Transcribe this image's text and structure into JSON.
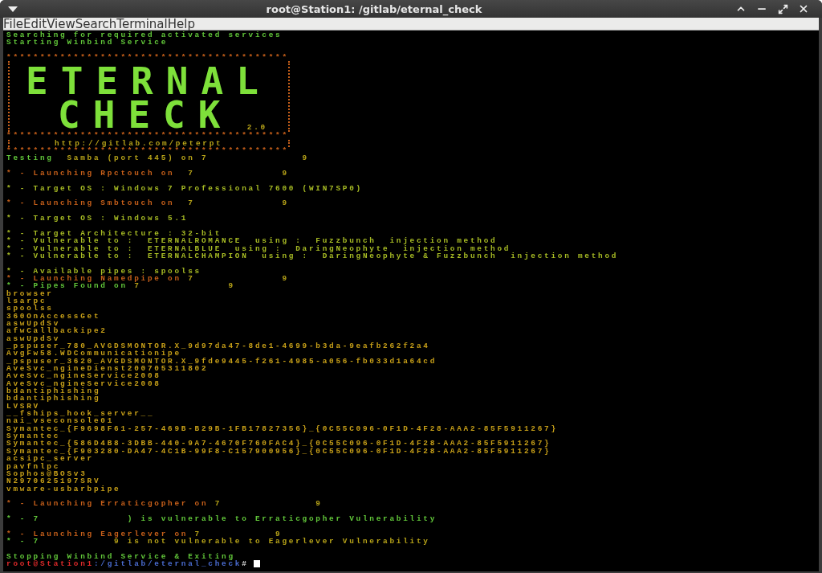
{
  "window": {
    "title": "root@Station1: /gitlab/eternal_check"
  },
  "menu": [
    "File",
    "Edit",
    "View",
    "Search",
    "Terminal",
    "Help"
  ],
  "output": [
    {
      "kind": "text",
      "lines": [
        [
          {
            "text": "Searching for required activated services",
            "color": "#62c83a"
          }
        ],
        [
          {
            "text": "Starting Winbind Service",
            "color": "#62c83a"
          }
        ]
      ]
    },
    {
      "kind": "banner",
      "border": "******************************************",
      "logo": [
        "ETERNAL",
        "CHECK"
      ],
      "version": "2.0",
      "url": "http://gitlab.com/peterpt"
    },
    {
      "kind": "text",
      "lines": [
        [
          {
            "text": "Testing  ",
            "color": "#62c83a"
          },
          {
            "text": "Samba (port 445) on 7              9",
            "color": "#b8a418"
          }
        ]
      ]
    },
    {
      "kind": "text",
      "lines": [
        [
          {
            "text": "* - Launching Rpctouch on ",
            "color": "#c8601a"
          },
          {
            "text": " 7             9",
            "color": "#b8a418"
          }
        ]
      ]
    },
    {
      "kind": "text",
      "lines": [
        [
          {
            "text": "* - Target OS : Windows 7 Professional 7600 (WIN7SP0)",
            "color": "#a8bc24"
          }
        ]
      ]
    },
    {
      "kind": "text",
      "lines": [
        [
          {
            "text": "* - Launching Smbtouch on ",
            "color": "#c8601a"
          },
          {
            "text": " 7             9",
            "color": "#b8a418"
          }
        ]
      ]
    },
    {
      "kind": "text",
      "lines": [
        [
          {
            "text": "* - Target OS : Windows 5.1",
            "color": "#a8bc24"
          }
        ]
      ]
    },
    {
      "kind": "text",
      "lines": [
        [
          {
            "text": "* - Target Architecture : 32-bit",
            "color": "#a8bc24"
          }
        ],
        [
          {
            "text": "* - Vulnerable to :  ETERNALROMANCE  using :  Fuzzbunch  injection method",
            "color": "#a8bc24"
          }
        ],
        [
          {
            "text": "* - Vulnerable to :  ETERNALBLUE  using :  DaringNeophyte  injection method",
            "color": "#a8bc24"
          }
        ],
        [
          {
            "text": "* - Vulnerable to :  ETERNALCHAMPION  using :  DaringNeophyte & Fuzzbunch  injection method",
            "color": "#a8bc24"
          }
        ]
      ]
    },
    {
      "kind": "text",
      "lines": [
        [
          {
            "text": "* - Available pipes : spoolss",
            "color": "#a8bc24"
          }
        ],
        [
          {
            "text": "* - Launching Namedpipe on ",
            "color": "#c8601a"
          },
          {
            "text": "7             9",
            "color": "#b8a418"
          }
        ],
        [
          {
            "text": "* - Pipes Found on ",
            "color": "#62c83a"
          },
          {
            "text": "7             9",
            "color": "#b8a418"
          }
        ],
        [
          {
            "text": "browser",
            "color": "#c8a018"
          }
        ],
        [
          {
            "text": "lsarpc",
            "color": "#c8a018"
          }
        ],
        [
          {
            "text": "spoolss",
            "color": "#c8a018"
          }
        ],
        [
          {
            "text": "360OnAccessGet",
            "color": "#c8a018"
          }
        ],
        [
          {
            "text": "aswUpdSv",
            "color": "#c8a018"
          }
        ],
        [
          {
            "text": "afwCallbackipe2",
            "color": "#c8a018"
          }
        ],
        [
          {
            "text": "aswUpdSv",
            "color": "#c8a018"
          }
        ],
        [
          {
            "text": "_pspuser_780_AVGDSMONTOR.X_9d97da47-8de1-4699-b3da-9eafb262f2a4",
            "color": "#c8a018"
          }
        ],
        [
          {
            "text": "AvgFw58.WDCommunicationipe",
            "color": "#c8a018"
          }
        ],
        [
          {
            "text": "_pspuser_3620_AVGDSMONTOR.X_9fde9445-f261-4985-a056-fb033d1a64cd",
            "color": "#c8a018"
          }
        ],
        [
          {
            "text": "AveSvc_ngineDienst200705311802",
            "color": "#c8a018"
          }
        ],
        [
          {
            "text": "AveSvc_ngineService2008",
            "color": "#c8a018"
          }
        ],
        [
          {
            "text": "AveSvc_ngineService2008",
            "color": "#c8a018"
          }
        ],
        [
          {
            "text": "bdantiphishing",
            "color": "#c8a018"
          }
        ],
        [
          {
            "text": "bdantiphishing",
            "color": "#c8a018"
          }
        ],
        [
          {
            "text": "LVSRV",
            "color": "#c8a018"
          }
        ],
        [
          {
            "text": "__fships_hook_server__",
            "color": "#c8a018"
          }
        ],
        [
          {
            "text": "nai_vseconsole01",
            "color": "#c8a018"
          }
        ],
        [
          {
            "text": "Symantec_{F9698F61-257-469B-B29B-1FB17827356}_{0C55C096-0F1D-4F28-AAA2-85F5911267}",
            "color": "#c8a018"
          }
        ],
        [
          {
            "text": "Symantec",
            "color": "#c8a018"
          }
        ],
        [
          {
            "text": "Symantec_{586D4B8-3DBB-440-9A7-4670F760FAC4}_{0C55C096-0F1D-4F28-AAA2-85F5911267}",
            "color": "#c8a018"
          }
        ],
        [
          {
            "text": "Symantec_{F903280-DA47-4C1B-99F8-C157900956}_{0C55C096-0F1D-4F28-AAA2-85F5911267}",
            "color": "#c8a018"
          }
        ],
        [
          {
            "text": "acsipc_server",
            "color": "#c8a018"
          }
        ],
        [
          {
            "text": "pavfnlpc",
            "color": "#c8a018"
          }
        ],
        [
          {
            "text": "Sophos@BOSv3",
            "color": "#c8a018"
          }
        ],
        [
          {
            "text": "N2970625197SRV",
            "color": "#c8a018"
          }
        ],
        [
          {
            "text": "vmware-usbarbpipe",
            "color": "#c8a018"
          }
        ]
      ]
    },
    {
      "kind": "text",
      "lines": [
        [
          {
            "text": "* - Launching Erraticgopher on ",
            "color": "#c8601a"
          },
          {
            "text": "7              9",
            "color": "#b8a418"
          }
        ]
      ]
    },
    {
      "kind": "text",
      "lines": [
        [
          {
            "text": "* - 7             ) is vulnerable to Erraticgopher Vulnerability",
            "color": "#62c83a"
          }
        ]
      ]
    },
    {
      "kind": "text",
      "lines": [
        [
          {
            "text": "* - Launching Eagerlever on ",
            "color": "#c8601a"
          },
          {
            "text": "7           9",
            "color": "#b8a418"
          }
        ],
        [
          {
            "text": "* - 7           ",
            "color": "#62c83a"
          },
          {
            "text": "9 is not vulnerable to Eagerlever Vulnerability",
            "color": "#b8a418"
          }
        ]
      ]
    },
    {
      "kind": "text",
      "lines": [
        [
          {
            "text": "Stopping Winbind Service & Exiting",
            "color": "#62c83a"
          }
        ]
      ]
    }
  ],
  "prompt": {
    "user": "root@Station1",
    "path": ":/gitlab/eternal_check",
    "symbol": "#"
  }
}
